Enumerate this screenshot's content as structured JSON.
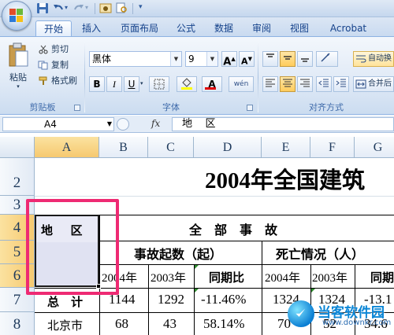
{
  "quick_access": {
    "undo_title": "撤消",
    "redo_title": "恢复"
  },
  "tabs": [
    "开始",
    "插入",
    "页面布局",
    "公式",
    "数据",
    "审阅",
    "视图",
    "Acrobat"
  ],
  "ribbon": {
    "clipboard": {
      "paste": "粘贴",
      "cut": "剪切",
      "copy": "复制",
      "format_painter": "格式刷",
      "label": "剪贴板"
    },
    "font": {
      "name": "黑体",
      "size": "9",
      "grow": "A",
      "shrink": "A",
      "bold": "B",
      "italic": "I",
      "underline": "U",
      "font_color": "A",
      "phonetic": "wén",
      "label": "字体"
    },
    "alignment": {
      "label": "对齐方式",
      "wrap": "自动换",
      "merge": "合并后"
    }
  },
  "formula_bar": {
    "name_box": "A4",
    "fx": "fx",
    "content": "地    区"
  },
  "sheet": {
    "columns": [
      "A",
      "B",
      "C",
      "D",
      "E",
      "F",
      "G"
    ],
    "rows": [
      "2",
      "3",
      "4",
      "5",
      "6",
      "7",
      "8"
    ],
    "title": "2004年全国建筑",
    "region_header": "地      区",
    "all_accidents": "全    部    事    故",
    "accident_count": "事故起数（起）",
    "death_status": "死亡情况（人）",
    "y2004a": "2004年",
    "y2003a": "2003年",
    "yoy_a": "同期比",
    "y2004b": "2004年",
    "y2003b": "2003年",
    "yoy_b": "同期",
    "total_label": "总    计",
    "total": [
      "1144",
      "1292",
      "-11.46%",
      "1324",
      "1324",
      "-13.1"
    ],
    "beijing_label": "北京市",
    "beijing": [
      "68",
      "43",
      "58.14%",
      "70",
      "52",
      "34.6"
    ]
  },
  "watermark": {
    "title": "当客软件园",
    "url": "www.downkr.com"
  }
}
